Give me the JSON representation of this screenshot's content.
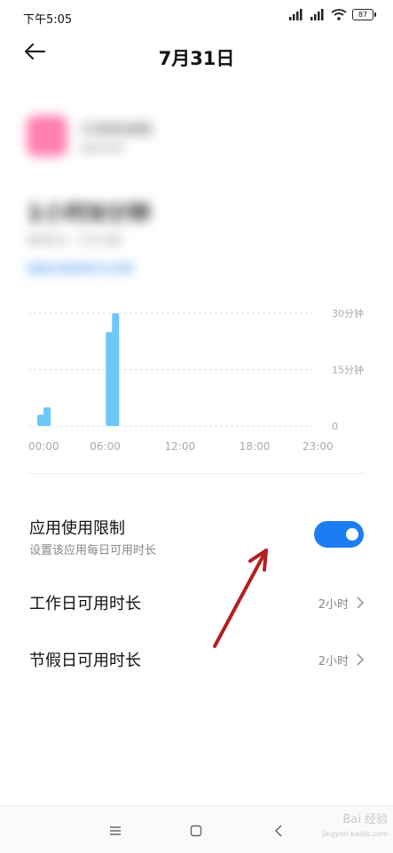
{
  "status": {
    "time": "下午5:05",
    "battery": "87"
  },
  "header": {
    "title": "7月31日"
  },
  "app_info": {
    "name": "抖音极速版",
    "subtitle": "版本信息",
    "total": "1小时8分钟",
    "detail": "使用时长 · 打开次数",
    "link": "查看应用使用时长详情"
  },
  "chart_data": {
    "type": "bar",
    "x_tick_labels": [
      "00:00",
      "06:00",
      "12:00",
      "18:00",
      "23:00"
    ],
    "y_tick_labels": [
      "30分钟",
      "15分钟",
      "0"
    ],
    "ylim": [
      0,
      30
    ],
    "series": [
      {
        "values": [
          {
            "hour": 1.0,
            "minutes": 3
          },
          {
            "hour": 1.5,
            "minutes": 5
          },
          {
            "hour": 6.5,
            "minutes": 25
          },
          {
            "hour": 7.0,
            "minutes": 30
          }
        ]
      }
    ],
    "bar_color": "#6cc8f7"
  },
  "limits": {
    "title": "应用使用限制",
    "subtitle": "设置该应用每日可用时长",
    "enabled": true,
    "workday_label": "工作日可用时长",
    "workday_value": "2小时",
    "holiday_label": "节假日可用时长",
    "holiday_value": "2小时"
  },
  "watermark": {
    "main": "Bai 经验",
    "sub": "jingyan.baidu.com"
  },
  "colors": {
    "accent": "#1d7cf2",
    "arrow": "#b41f1f"
  }
}
